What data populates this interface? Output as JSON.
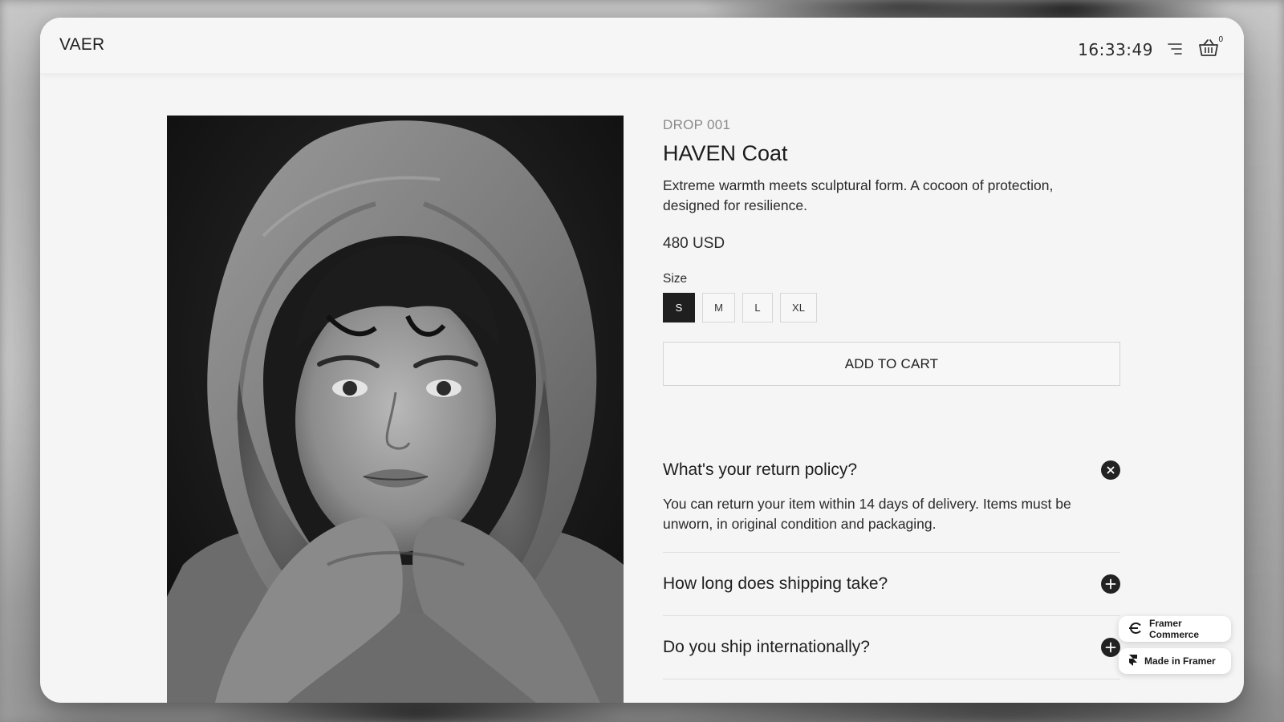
{
  "header": {
    "logo": "VAER",
    "clock": "16:33:49",
    "cart_count": "0",
    "menu_icon": "menu-icon",
    "cart_icon": "basket-icon"
  },
  "product": {
    "eyebrow": "DROP 001",
    "name": "HAVEN Coat",
    "description": "Extreme warmth meets sculptural form. A cocoon of protection, designed for resilience.",
    "price": "480 USD",
    "size_label": "Size",
    "sizes": [
      "S",
      "M",
      "L",
      "XL"
    ],
    "selected_size": "S",
    "add_to_cart": "ADD TO CART"
  },
  "faq": [
    {
      "question": "What's your return policy?",
      "answer": "You can return your item within 14 days of delivery. Items must be unworn, in original condition and packaging.",
      "open": true
    },
    {
      "question": "How long does shipping take?",
      "open": false
    },
    {
      "question": "Do you ship internationally?",
      "open": false
    }
  ],
  "badges": {
    "commerce": "Framer Commerce",
    "framer": "Made in Framer"
  },
  "colors": {
    "page_bg": "#f5f5f5",
    "accent_dark": "#1f1f1f",
    "muted_text": "#8a8a8a"
  }
}
